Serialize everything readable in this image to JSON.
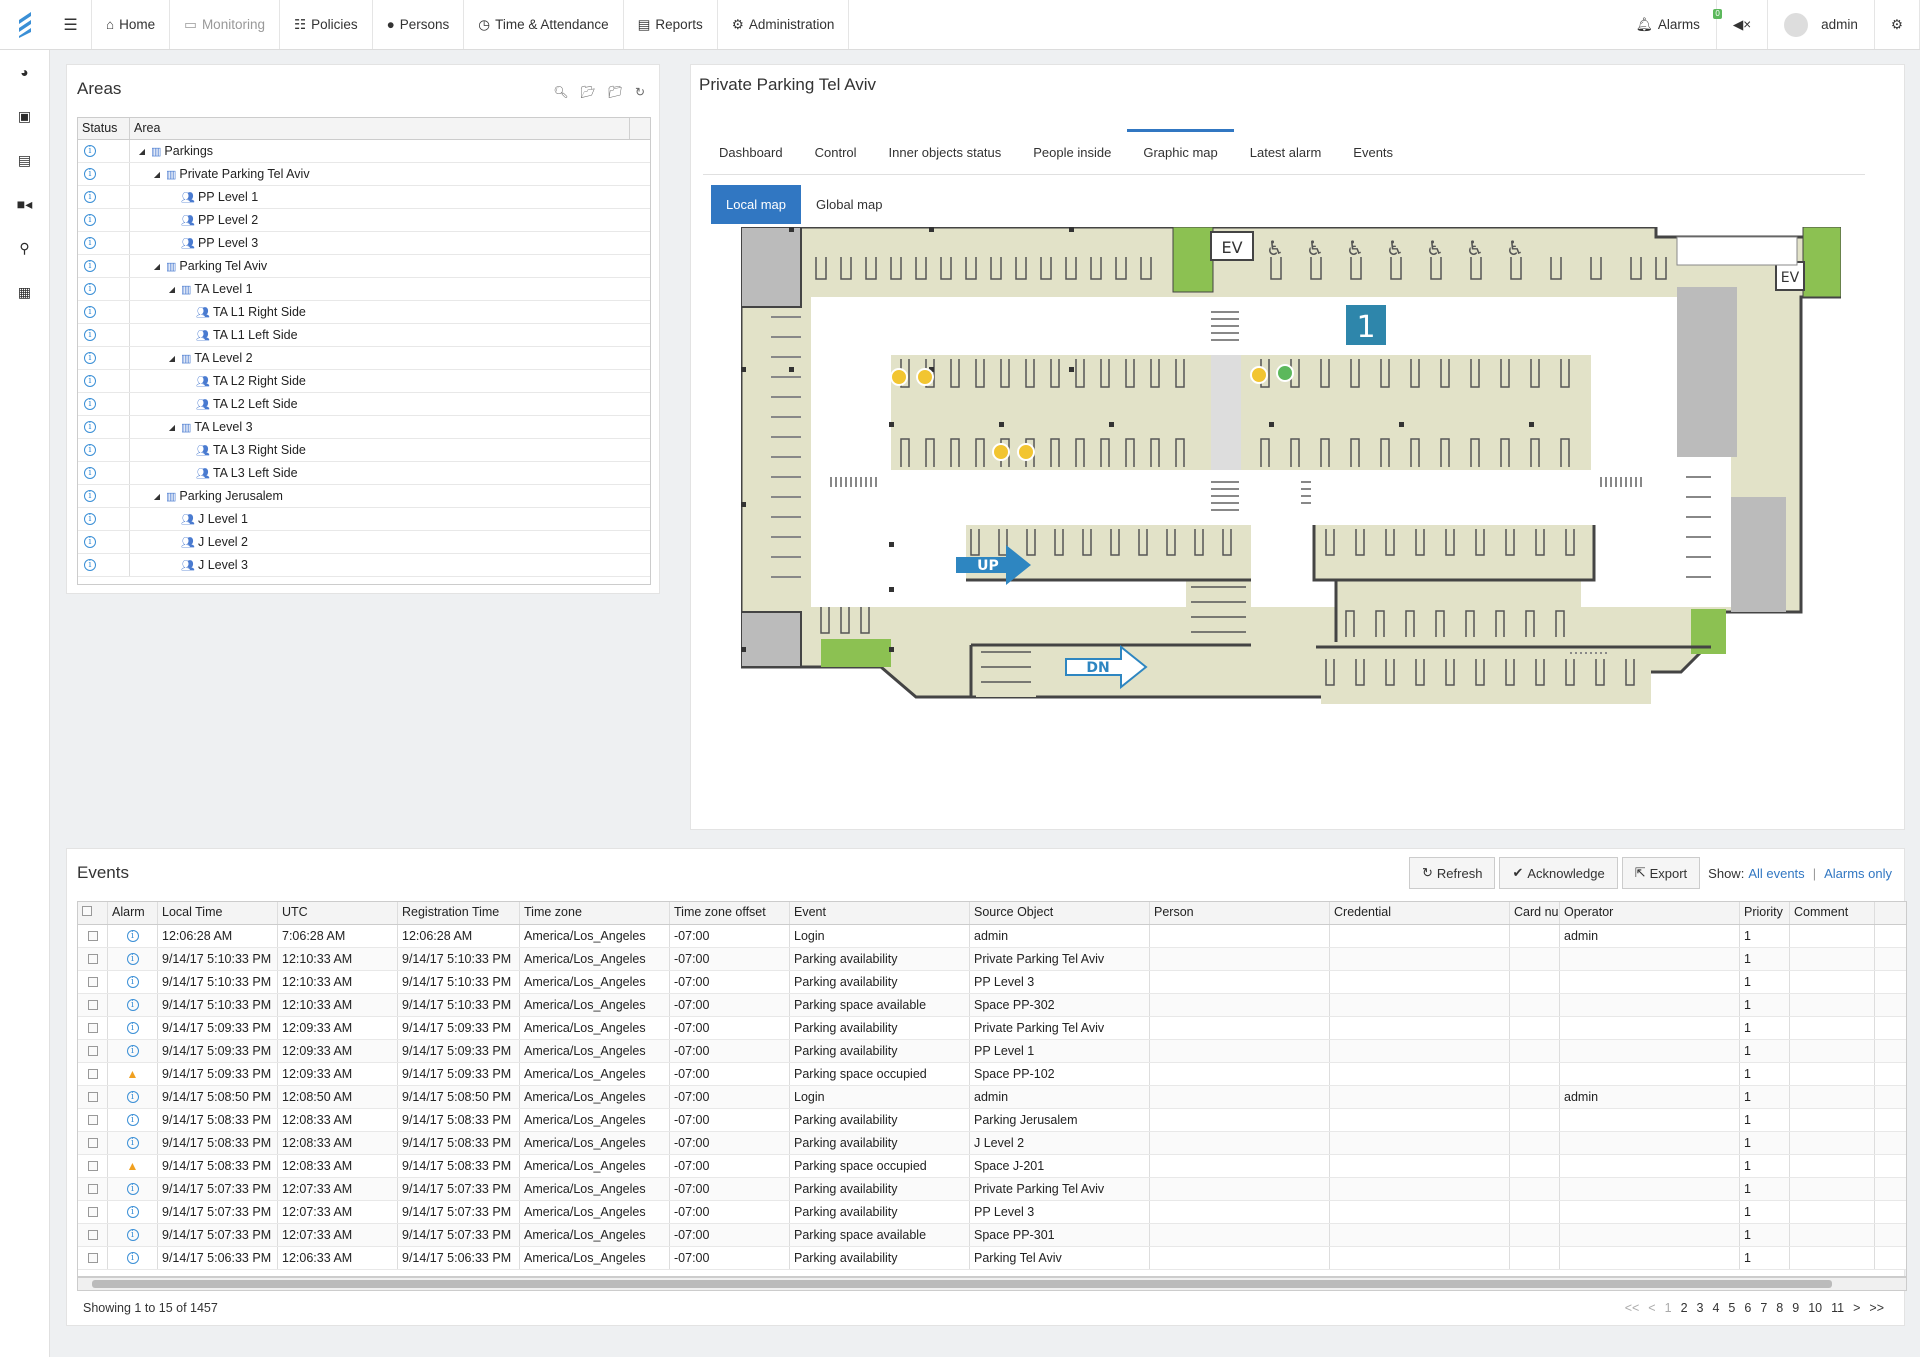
{
  "topbar": {
    "items": [
      {
        "icon": "home-icon",
        "label": "Home"
      },
      {
        "icon": "monitor-icon",
        "label": "Monitoring",
        "disabled": true
      },
      {
        "icon": "sliders-icon",
        "label": "Policies"
      },
      {
        "icon": "user-icon",
        "label": "Persons"
      },
      {
        "icon": "clock-icon",
        "label": "Time & Attendance"
      },
      {
        "icon": "report-icon",
        "label": "Reports"
      },
      {
        "icon": "gear-icon",
        "label": "Administration"
      }
    ],
    "alarms_label": "Alarms",
    "alarms_badge": "0",
    "user": "admin"
  },
  "areas": {
    "title": "Areas",
    "col_status": "Status",
    "col_area": "Area",
    "rows": [
      {
        "label": "Parkings",
        "level": 0,
        "type": "building",
        "expand": true
      },
      {
        "label": "Private Parking Tel Aviv",
        "level": 1,
        "type": "building",
        "expand": true
      },
      {
        "label": "PP Level 1",
        "level": 2,
        "type": "people"
      },
      {
        "label": "PP Level 2",
        "level": 2,
        "type": "people"
      },
      {
        "label": "PP Level 3",
        "level": 2,
        "type": "people"
      },
      {
        "label": "Parking Tel Aviv",
        "level": 1,
        "type": "building",
        "expand": true
      },
      {
        "label": "TA Level 1",
        "level": 2,
        "type": "building",
        "expand": true
      },
      {
        "label": "TA L1 Right Side",
        "level": 3,
        "type": "people"
      },
      {
        "label": "TA L1 Left Side",
        "level": 3,
        "type": "people"
      },
      {
        "label": "TA Level 2",
        "level": 2,
        "type": "building",
        "expand": true
      },
      {
        "label": "TA L2 Right Side",
        "level": 3,
        "type": "people"
      },
      {
        "label": "TA L2 Left Side",
        "level": 3,
        "type": "people"
      },
      {
        "label": "TA Level 3",
        "level": 2,
        "type": "building",
        "expand": true
      },
      {
        "label": "TA L3 Right Side",
        "level": 3,
        "type": "people"
      },
      {
        "label": "TA L3 Left Side",
        "level": 3,
        "type": "people"
      },
      {
        "label": "Parking Jerusalem",
        "level": 1,
        "type": "building",
        "expand": true
      },
      {
        "label": "J Level 1",
        "level": 2,
        "type": "people"
      },
      {
        "label": "J Level 2",
        "level": 2,
        "type": "people"
      },
      {
        "label": "J Level 3",
        "level": 2,
        "type": "people"
      }
    ]
  },
  "detail": {
    "title": "Private Parking Tel Aviv",
    "tabs": [
      "Dashboard",
      "Control",
      "Inner objects status",
      "People inside",
      "Graphic map",
      "Latest alarm",
      "Events"
    ],
    "active_tab": 4,
    "subtabs": [
      "Local map",
      "Global map"
    ],
    "active_subtab": 0,
    "map": {
      "level_number": "1",
      "up_label": "UP",
      "dn_label": "DN",
      "ev_label": "EV"
    }
  },
  "events": {
    "title": "Events",
    "refresh": "Refresh",
    "acknowledge": "Acknowledge",
    "export": "Export",
    "show_label": "Show:",
    "all_events": "All events",
    "alarms_only": "Alarms only",
    "columns": [
      "Alarm",
      "Local Time",
      "UTC",
      "Registration Time",
      "Time zone",
      "Time zone offset",
      "Event",
      "Source Object",
      "Person",
      "Credential",
      "Card nu",
      "Operator",
      "Priority",
      "Comment"
    ],
    "rows": [
      {
        "alarm": "info",
        "local": "12:06:28 AM",
        "utc": "7:06:28 AM",
        "reg": "12:06:28 AM",
        "tz": "America/Los_Angeles",
        "off": "-07:00",
        "event": "Login",
        "source": "admin",
        "operator": "admin",
        "priority": "1"
      },
      {
        "alarm": "info",
        "local": "9/14/17 5:10:33 PM",
        "utc": "12:10:33 AM",
        "reg": "9/14/17 5:10:33 PM",
        "tz": "America/Los_Angeles",
        "off": "-07:00",
        "event": "Parking availability",
        "source": "Private Parking Tel Aviv",
        "operator": "",
        "priority": "1"
      },
      {
        "alarm": "info",
        "local": "9/14/17 5:10:33 PM",
        "utc": "12:10:33 AM",
        "reg": "9/14/17 5:10:33 PM",
        "tz": "America/Los_Angeles",
        "off": "-07:00",
        "event": "Parking availability",
        "source": "PP Level 3",
        "operator": "",
        "priority": "1"
      },
      {
        "alarm": "info",
        "local": "9/14/17 5:10:33 PM",
        "utc": "12:10:33 AM",
        "reg": "9/14/17 5:10:33 PM",
        "tz": "America/Los_Angeles",
        "off": "-07:00",
        "event": "Parking space available",
        "source": "Space PP-302",
        "operator": "",
        "priority": "1"
      },
      {
        "alarm": "info",
        "local": "9/14/17 5:09:33 PM",
        "utc": "12:09:33 AM",
        "reg": "9/14/17 5:09:33 PM",
        "tz": "America/Los_Angeles",
        "off": "-07:00",
        "event": "Parking availability",
        "source": "Private Parking Tel Aviv",
        "operator": "",
        "priority": "1"
      },
      {
        "alarm": "info",
        "local": "9/14/17 5:09:33 PM",
        "utc": "12:09:33 AM",
        "reg": "9/14/17 5:09:33 PM",
        "tz": "America/Los_Angeles",
        "off": "-07:00",
        "event": "Parking availability",
        "source": "PP Level 1",
        "operator": "",
        "priority": "1"
      },
      {
        "alarm": "warn",
        "local": "9/14/17 5:09:33 PM",
        "utc": "12:09:33 AM",
        "reg": "9/14/17 5:09:33 PM",
        "tz": "America/Los_Angeles",
        "off": "-07:00",
        "event": "Parking space occupied",
        "source": "Space PP-102",
        "operator": "",
        "priority": "1"
      },
      {
        "alarm": "info",
        "local": "9/14/17 5:08:50 PM",
        "utc": "12:08:50 AM",
        "reg": "9/14/17 5:08:50 PM",
        "tz": "America/Los_Angeles",
        "off": "-07:00",
        "event": "Login",
        "source": "admin",
        "operator": "admin",
        "priority": "1"
      },
      {
        "alarm": "info",
        "local": "9/14/17 5:08:33 PM",
        "utc": "12:08:33 AM",
        "reg": "9/14/17 5:08:33 PM",
        "tz": "America/Los_Angeles",
        "off": "-07:00",
        "event": "Parking availability",
        "source": "Parking Jerusalem",
        "operator": "",
        "priority": "1"
      },
      {
        "alarm": "info",
        "local": "9/14/17 5:08:33 PM",
        "utc": "12:08:33 AM",
        "reg": "9/14/17 5:08:33 PM",
        "tz": "America/Los_Angeles",
        "off": "-07:00",
        "event": "Parking availability",
        "source": "J Level 2",
        "operator": "",
        "priority": "1"
      },
      {
        "alarm": "warn",
        "local": "9/14/17 5:08:33 PM",
        "utc": "12:08:33 AM",
        "reg": "9/14/17 5:08:33 PM",
        "tz": "America/Los_Angeles",
        "off": "-07:00",
        "event": "Parking space occupied",
        "source": "Space J-201",
        "operator": "",
        "priority": "1"
      },
      {
        "alarm": "info",
        "local": "9/14/17 5:07:33 PM",
        "utc": "12:07:33 AM",
        "reg": "9/14/17 5:07:33 PM",
        "tz": "America/Los_Angeles",
        "off": "-07:00",
        "event": "Parking availability",
        "source": "Private Parking Tel Aviv",
        "operator": "",
        "priority": "1"
      },
      {
        "alarm": "info",
        "local": "9/14/17 5:07:33 PM",
        "utc": "12:07:33 AM",
        "reg": "9/14/17 5:07:33 PM",
        "tz": "America/Los_Angeles",
        "off": "-07:00",
        "event": "Parking availability",
        "source": "PP Level 3",
        "operator": "",
        "priority": "1"
      },
      {
        "alarm": "info",
        "local": "9/14/17 5:07:33 PM",
        "utc": "12:07:33 AM",
        "reg": "9/14/17 5:07:33 PM",
        "tz": "America/Los_Angeles",
        "off": "-07:00",
        "event": "Parking space available",
        "source": "Space PP-301",
        "operator": "",
        "priority": "1"
      },
      {
        "alarm": "info",
        "local": "9/14/17 5:06:33 PM",
        "utc": "12:06:33 AM",
        "reg": "9/14/17 5:06:33 PM",
        "tz": "America/Los_Angeles",
        "off": "-07:00",
        "event": "Parking availability",
        "source": "Parking Tel Aviv",
        "operator": "",
        "priority": "1"
      }
    ],
    "footer": "Showing 1 to 15 of 1457",
    "pager": [
      "<<",
      "<",
      "1",
      "2",
      "3",
      "4",
      "5",
      "6",
      "7",
      "8",
      "9",
      "10",
      "11",
      ">",
      ">>"
    ]
  },
  "colors": {
    "accent": "#3177c2",
    "map_floor": "#e2e2c8",
    "map_green": "#8cc152",
    "map_gray": "#b5b5b5",
    "occupied": "#f2c531",
    "available": "#5cb85c"
  }
}
